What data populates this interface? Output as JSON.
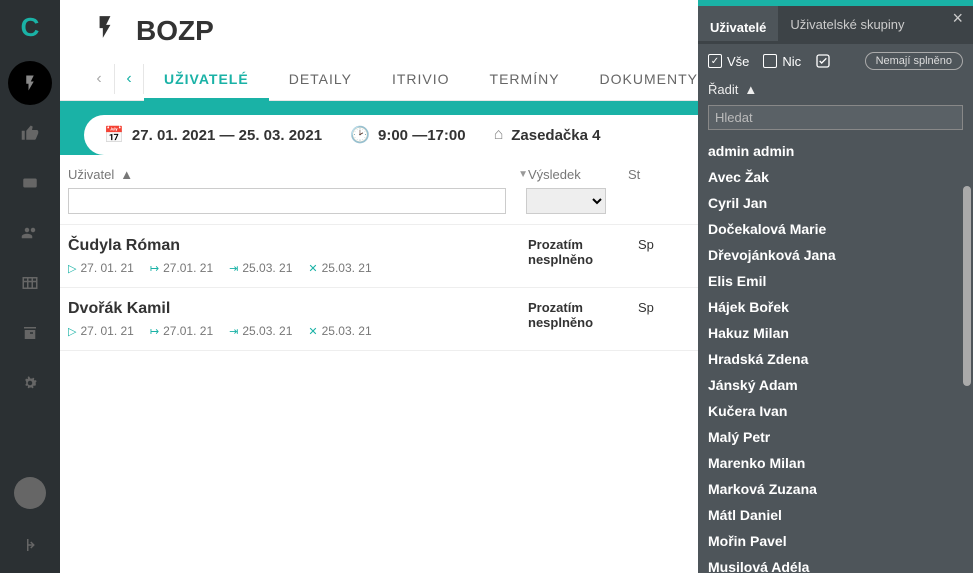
{
  "sidebar": {
    "logo": "C"
  },
  "header": {
    "title": "BOZP"
  },
  "tabs": [
    {
      "label": "UŽIVATELÉ",
      "active": true
    },
    {
      "label": "DETAILY"
    },
    {
      "label": "ITRIVIO"
    },
    {
      "label": "TERMÍNY"
    },
    {
      "label": "DOKUMENTY"
    }
  ],
  "infobar": {
    "date_range": "27. 01. 2021 — 25. 03. 2021",
    "time_range": "9:00 —17:00",
    "location": "Zasedačka 4"
  },
  "table": {
    "headers": {
      "user": "Uživatel",
      "result": "Výsledek",
      "status": "St"
    },
    "rows": [
      {
        "name": "Čudyla Róman",
        "d1": "27. 01. 21",
        "d2": "27.01. 21",
        "d3": "25.03. 21",
        "d4": "25.03. 21",
        "result_l1": "Prozatím",
        "result_l2": "nesplněno",
        "status": "Sp"
      },
      {
        "name": "Dvořák Kamil",
        "d1": "27. 01. 21",
        "d2": "27.01. 21",
        "d3": "25.03. 21",
        "d4": "25.03. 21",
        "result_l1": "Prozatím",
        "result_l2": "nesplněno",
        "status": "Sp"
      }
    ]
  },
  "drawer": {
    "tab_users": "Uživatelé",
    "tab_groups": "Uživatelské skupiny",
    "chk_all": "Vše",
    "chk_none": "Nic",
    "btn_missing": "Nemají splněno",
    "sort_label": "Řadit",
    "search_placeholder": "Hledat",
    "users": [
      "admin admin",
      "Avec Žak",
      "Cyril Jan",
      "Dočekalová Marie",
      "Dřevojánková Jana",
      "Elis Emil",
      "Hájek Bořek",
      "Hakuz Milan",
      "Hradská Zdena",
      "Jánský Adam",
      "Kučera Ivan",
      "Malý Petr",
      "Marenko Milan",
      "Marková Zuzana",
      "Mátl Daniel",
      "Mořin Pavel",
      "Musilová Adéla"
    ]
  }
}
